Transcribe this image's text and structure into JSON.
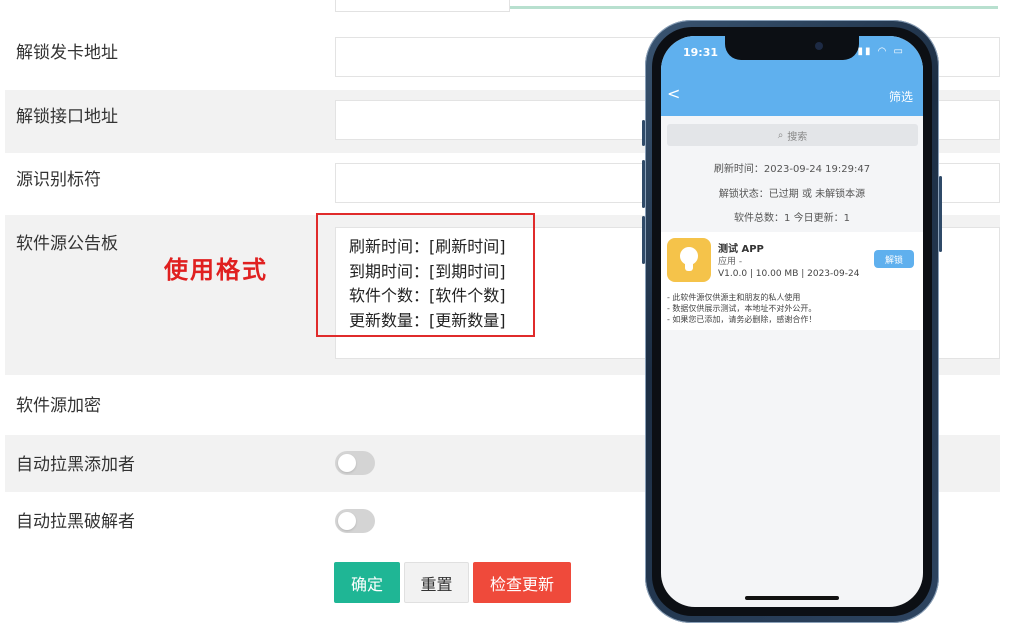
{
  "form": {
    "fields": [
      {
        "label": "解锁发卡地址"
      },
      {
        "label": "解锁接口地址"
      },
      {
        "label": "源识别标符"
      },
      {
        "label": "软件源公告板"
      },
      {
        "label": "软件源加密"
      },
      {
        "label": "自动拉黑添加者"
      },
      {
        "label": "自动拉黑破解者"
      }
    ],
    "buttons": {
      "confirm": "确定",
      "reset": "重置",
      "check_update": "检查更新"
    }
  },
  "annotation": {
    "title": "使用格式",
    "lines": [
      "刷新时间：[刷新时间]",
      "到期时间：[到期时间]",
      "软件个数：[软件个数]",
      "更新数量：[更新数量]"
    ]
  },
  "phone": {
    "status": {
      "time": "19:31"
    },
    "nav": {
      "back": "<",
      "filter": "筛选"
    },
    "search": {
      "placeholder": "搜索"
    },
    "info": {
      "refresh": "刷新时间：2023-09-24 19:29:47",
      "unlock_status": "解锁状态：已过期 或 未解锁本源",
      "counts": "软件总数：1   今日更新：1"
    },
    "app": {
      "name": "测试 APP",
      "type": "应用 -",
      "meta": "V1.0.0 | 10.00 MB | 2023-09-24",
      "unlock_label": "解锁",
      "icon": "lightbulb-icon"
    },
    "notes": [
      "- 此软件源仅供源主和朋友的私人使用",
      "- 数据仅供展示测试，本地址不对外公开。",
      "- 如果您已添加，请务必删除，感谢合作！"
    ]
  },
  "colors": {
    "confirm": "#1fb695",
    "check_update": "#ef4a3b",
    "annotation": "#e02020",
    "phone_header": "#5fb0ee",
    "app_icon": "#f5c34a"
  }
}
